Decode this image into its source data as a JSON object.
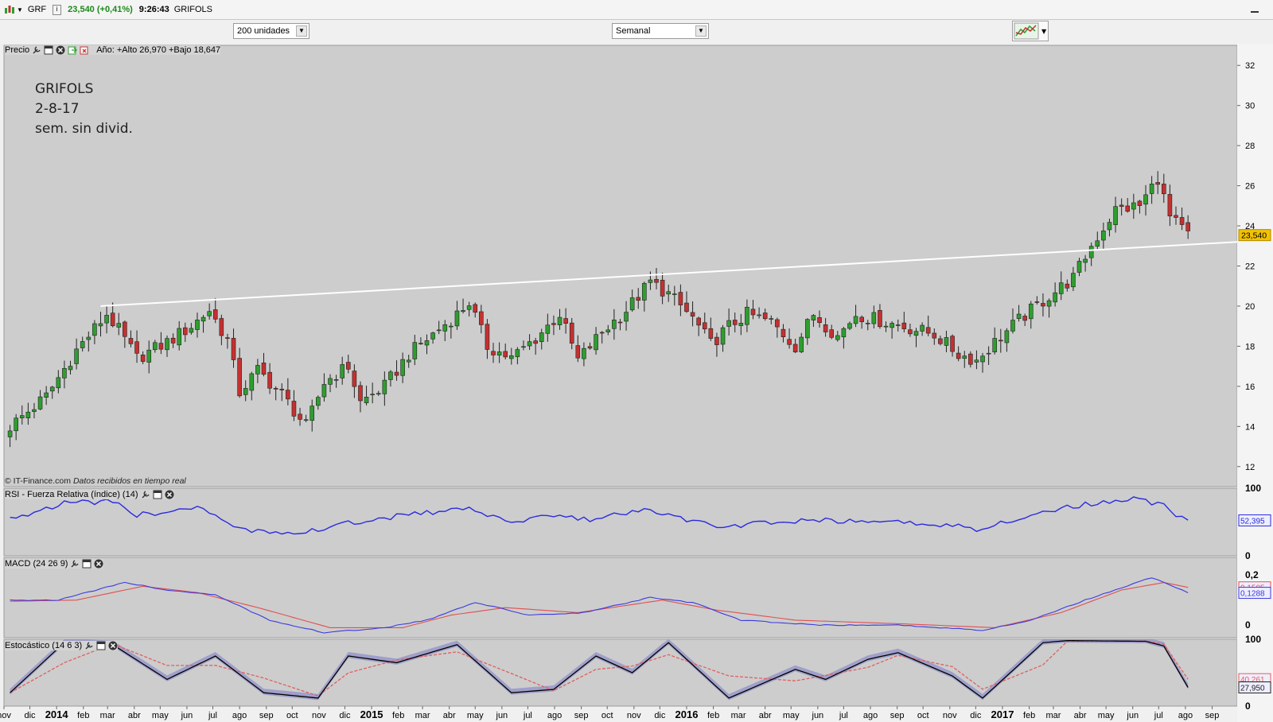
{
  "titlebar": {
    "symbol": "GRF",
    "price_change": "23,540 (+0,41%)",
    "time": "9:26:43",
    "name": "GRIFOLS"
  },
  "toolbar": {
    "units_select": "200 unidades",
    "period_select": "Semanal"
  },
  "price_panel": {
    "label": "Precio",
    "stats": "Año: +Alto 26,970 +Bajo 18,647",
    "last_price_badge": "23,540",
    "annotation_lines": [
      "GRIFOLS",
      "2-8-17",
      "sem. sin divid."
    ],
    "copyright": "© IT-Finance.com",
    "copyright_note": "Datos recibidos en tiempo real"
  },
  "rsi_panel": {
    "label": "RSI - Fuerza Relativa (índice) (14)",
    "value_badge": "52,395"
  },
  "macd_panel": {
    "label": "MACD (24 26 9)",
    "signal_badge": "0,1505",
    "macd_badge": "0,1288"
  },
  "stoch_panel": {
    "label": "Estocástico (14 6 3)",
    "d_badge": "40,261",
    "k_badge": "27,950"
  },
  "colors": {
    "bull": "#2e9e2e",
    "bear": "#c53030",
    "rsi": "#2a2ae0",
    "macd": "#3a3ae0",
    "signal": "#e05050",
    "k": "#000000",
    "d": "#e06060",
    "band": "#7a7ac8",
    "badge": "#f2c200"
  },
  "chart_data": [
    {
      "type": "candlestick",
      "title": "Precio",
      "ylim": [
        11,
        33
      ],
      "y_ticks": [
        "12",
        "14",
        "16",
        "18",
        "20",
        "22",
        "24",
        "26",
        "28",
        "30",
        "32"
      ],
      "x_tick_labels": [
        "nov",
        "dic",
        "2014",
        "feb",
        "mar",
        "abr",
        "may",
        "jun",
        "jul",
        "ago",
        "sep",
        "oct",
        "nov",
        "dic",
        "2015",
        "feb",
        "mar",
        "abr",
        "may",
        "jun",
        "jul",
        "ago",
        "sep",
        "oct",
        "nov",
        "dic",
        "2016",
        "feb",
        "mar",
        "abr",
        "may",
        "jun",
        "jul",
        "ago",
        "sep",
        "oct",
        "nov",
        "dic",
        "2017",
        "feb",
        "mar",
        "abr",
        "may",
        "jun",
        "jul",
        "ago",
        "sep"
      ],
      "x_range": [
        "2013-11-01",
        "2017-09-30"
      ],
      "trendline": {
        "from": [
          "2014-02-21",
          20.0
        ],
        "to": [
          "2017-09-30",
          23.2
        ]
      },
      "anchors": [
        [
          "2013-11-08",
          14.0
        ],
        [
          "2013-12-20",
          15.5
        ],
        [
          "2014-01-24",
          17.8
        ],
        [
          "2014-02-28",
          19.6
        ],
        [
          "2014-03-14",
          18.8
        ],
        [
          "2014-04-04",
          17.4
        ],
        [
          "2014-05-09",
          18.2
        ],
        [
          "2014-06-06",
          19.0
        ],
        [
          "2014-06-27",
          19.8
        ],
        [
          "2014-07-18",
          18.3
        ],
        [
          "2014-08-01",
          15.7
        ],
        [
          "2014-08-22",
          16.8
        ],
        [
          "2014-09-19",
          15.6
        ],
        [
          "2014-10-17",
          14.0
        ],
        [
          "2014-11-07",
          16.2
        ],
        [
          "2014-12-05",
          17.0
        ],
        [
          "2014-12-19",
          15.2
        ],
        [
          "2015-01-16",
          16.0
        ],
        [
          "2015-02-13",
          17.6
        ],
        [
          "2015-03-13",
          18.6
        ],
        [
          "2015-04-10",
          19.6
        ],
        [
          "2015-04-24",
          20.2
        ],
        [
          "2015-05-15",
          18.0
        ],
        [
          "2015-06-12",
          17.4
        ],
        [
          "2015-07-10",
          18.4
        ],
        [
          "2015-08-07",
          19.6
        ],
        [
          "2015-08-28",
          17.3
        ],
        [
          "2015-09-25",
          18.7
        ],
        [
          "2015-10-23",
          19.8
        ],
        [
          "2015-11-20",
          21.2
        ],
        [
          "2015-12-11",
          20.6
        ],
        [
          "2016-01-08",
          19.4
        ],
        [
          "2016-01-29",
          18.1
        ],
        [
          "2016-02-19",
          19.0
        ],
        [
          "2016-03-11",
          19.6
        ],
        [
          "2016-04-08",
          19.2
        ],
        [
          "2016-05-06",
          18.0
        ],
        [
          "2016-05-27",
          19.6
        ],
        [
          "2016-06-24",
          18.5
        ],
        [
          "2016-07-15",
          19.6
        ],
        [
          "2016-08-19",
          19.2
        ],
        [
          "2016-09-16",
          18.9
        ],
        [
          "2016-10-14",
          18.6
        ],
        [
          "2016-11-11",
          17.6
        ],
        [
          "2016-12-02",
          17.3
        ],
        [
          "2016-12-23",
          18.2
        ],
        [
          "2017-01-20",
          19.3
        ],
        [
          "2017-02-24",
          20.5
        ],
        [
          "2017-03-24",
          21.4
        ],
        [
          "2017-04-14",
          23.0
        ],
        [
          "2017-05-12",
          24.8
        ],
        [
          "2017-06-09",
          25.0
        ],
        [
          "2017-06-30",
          26.4
        ],
        [
          "2017-07-14",
          24.4
        ],
        [
          "2017-08-04",
          23.54
        ]
      ],
      "last": 23.54
    },
    {
      "type": "line",
      "title": "RSI - Fuerza Relativa (índice) (14)",
      "ylim": [
        0,
        100
      ],
      "y_ticks": [
        "0",
        "100"
      ],
      "series": [
        {
          "name": "RSI",
          "anchors": [
            [
              "2013-11-08",
              55
            ],
            [
              "2014-01-10",
              78
            ],
            [
              "2014-03-07",
              80
            ],
            [
              "2014-04-04",
              60
            ],
            [
              "2014-06-13",
              72
            ],
            [
              "2014-08-01",
              38
            ],
            [
              "2014-10-17",
              35
            ],
            [
              "2014-12-05",
              48
            ],
            [
              "2015-02-06",
              60
            ],
            [
              "2015-04-24",
              70
            ],
            [
              "2015-06-05",
              50
            ],
            [
              "2015-08-07",
              62
            ],
            [
              "2015-09-11",
              52
            ],
            [
              "2015-11-06",
              68
            ],
            [
              "2015-12-11",
              60
            ],
            [
              "2016-02-05",
              42
            ],
            [
              "2016-04-08",
              50
            ],
            [
              "2016-06-10",
              52
            ],
            [
              "2016-08-19",
              50
            ],
            [
              "2016-11-04",
              45
            ],
            [
              "2016-12-02",
              40
            ],
            [
              "2017-01-27",
              58
            ],
            [
              "2017-03-17",
              72
            ],
            [
              "2017-06-02",
              85
            ],
            [
              "2017-07-07",
              75
            ],
            [
              "2017-07-21",
              58
            ],
            [
              "2017-08-04",
              52.395
            ]
          ]
        }
      ],
      "last": 52.395
    },
    {
      "type": "line",
      "title": "MACD (24 26 9)",
      "ylim": [
        -0.05,
        0.27
      ],
      "y_ticks": [
        "0",
        "0,2"
      ],
      "series": [
        {
          "name": "MACD",
          "anchors": [
            [
              "2013-11-08",
              0.1
            ],
            [
              "2014-01-03",
              0.1
            ],
            [
              "2014-03-21",
              0.17
            ],
            [
              "2014-05-09",
              0.14
            ],
            [
              "2014-07-04",
              0.12
            ],
            [
              "2014-09-05",
              0.02
            ],
            [
              "2014-11-07",
              -0.03
            ],
            [
              "2015-01-16",
              -0.01
            ],
            [
              "2015-03-06",
              0.02
            ],
            [
              "2015-05-01",
              0.09
            ],
            [
              "2015-07-03",
              0.04
            ],
            [
              "2015-09-04",
              0.05
            ],
            [
              "2015-11-20",
              0.11
            ],
            [
              "2016-01-08",
              0.09
            ],
            [
              "2016-03-04",
              0.02
            ],
            [
              "2016-06-03",
              0.0
            ],
            [
              "2016-09-02",
              0.0
            ],
            [
              "2016-12-09",
              -0.02
            ],
            [
              "2017-02-03",
              0.02
            ],
            [
              "2017-04-07",
              0.1
            ],
            [
              "2017-06-23",
              0.19
            ],
            [
              "2017-08-04",
              0.1288
            ]
          ]
        },
        {
          "name": "Señal",
          "anchors": [
            [
              "2013-11-08",
              0.095
            ],
            [
              "2014-01-24",
              0.1
            ],
            [
              "2014-04-11",
              0.155
            ],
            [
              "2014-06-13",
              0.13
            ],
            [
              "2014-08-22",
              0.07
            ],
            [
              "2014-11-14",
              -0.01
            ],
            [
              "2015-02-06",
              -0.01
            ],
            [
              "2015-04-03",
              0.04
            ],
            [
              "2015-06-05",
              0.07
            ],
            [
              "2015-08-28",
              0.05
            ],
            [
              "2015-12-04",
              0.1
            ],
            [
              "2016-02-05",
              0.06
            ],
            [
              "2016-05-06",
              0.02
            ],
            [
              "2016-09-09",
              0.005
            ],
            [
              "2016-12-23",
              -0.01
            ],
            [
              "2017-03-10",
              0.05
            ],
            [
              "2017-05-19",
              0.14
            ],
            [
              "2017-07-07",
              0.17
            ],
            [
              "2017-08-04",
              0.1505
            ]
          ]
        }
      ],
      "last_macd": 0.1288,
      "last_signal": 0.1505
    },
    {
      "type": "line",
      "title": "Estocástico (14 6 3)",
      "ylim": [
        0,
        100
      ],
      "y_ticks": [
        "0",
        "100"
      ],
      "series": [
        {
          "name": "%K",
          "anchors": [
            [
              "2013-11-08",
              20
            ],
            [
              "2014-01-10",
              95
            ],
            [
              "2014-03-07",
              92
            ],
            [
              "2014-05-09",
              40
            ],
            [
              "2014-07-04",
              75
            ],
            [
              "2014-08-29",
              20
            ],
            [
              "2014-10-31",
              12
            ],
            [
              "2014-12-05",
              75
            ],
            [
              "2015-01-30",
              65
            ],
            [
              "2015-04-10",
              92
            ],
            [
              "2015-06-12",
              20
            ],
            [
              "2015-07-31",
              25
            ],
            [
              "2015-09-18",
              75
            ],
            [
              "2015-10-30",
              50
            ],
            [
              "2015-12-11",
              95
            ],
            [
              "2016-02-19",
              12
            ],
            [
              "2016-05-06",
              55
            ],
            [
              "2016-06-10",
              40
            ],
            [
              "2016-07-29",
              70
            ],
            [
              "2016-09-02",
              80
            ],
            [
              "2016-11-04",
              45
            ],
            [
              "2016-12-09",
              12
            ],
            [
              "2017-02-17",
              95
            ],
            [
              "2017-03-17",
              98
            ],
            [
              "2017-06-16",
              97
            ],
            [
              "2017-07-07",
              90
            ],
            [
              "2017-08-04",
              27.95
            ]
          ]
        },
        {
          "name": "%D",
          "lastValue": 40.261
        }
      ],
      "last_k": 27.95,
      "last_d": 40.261
    }
  ]
}
